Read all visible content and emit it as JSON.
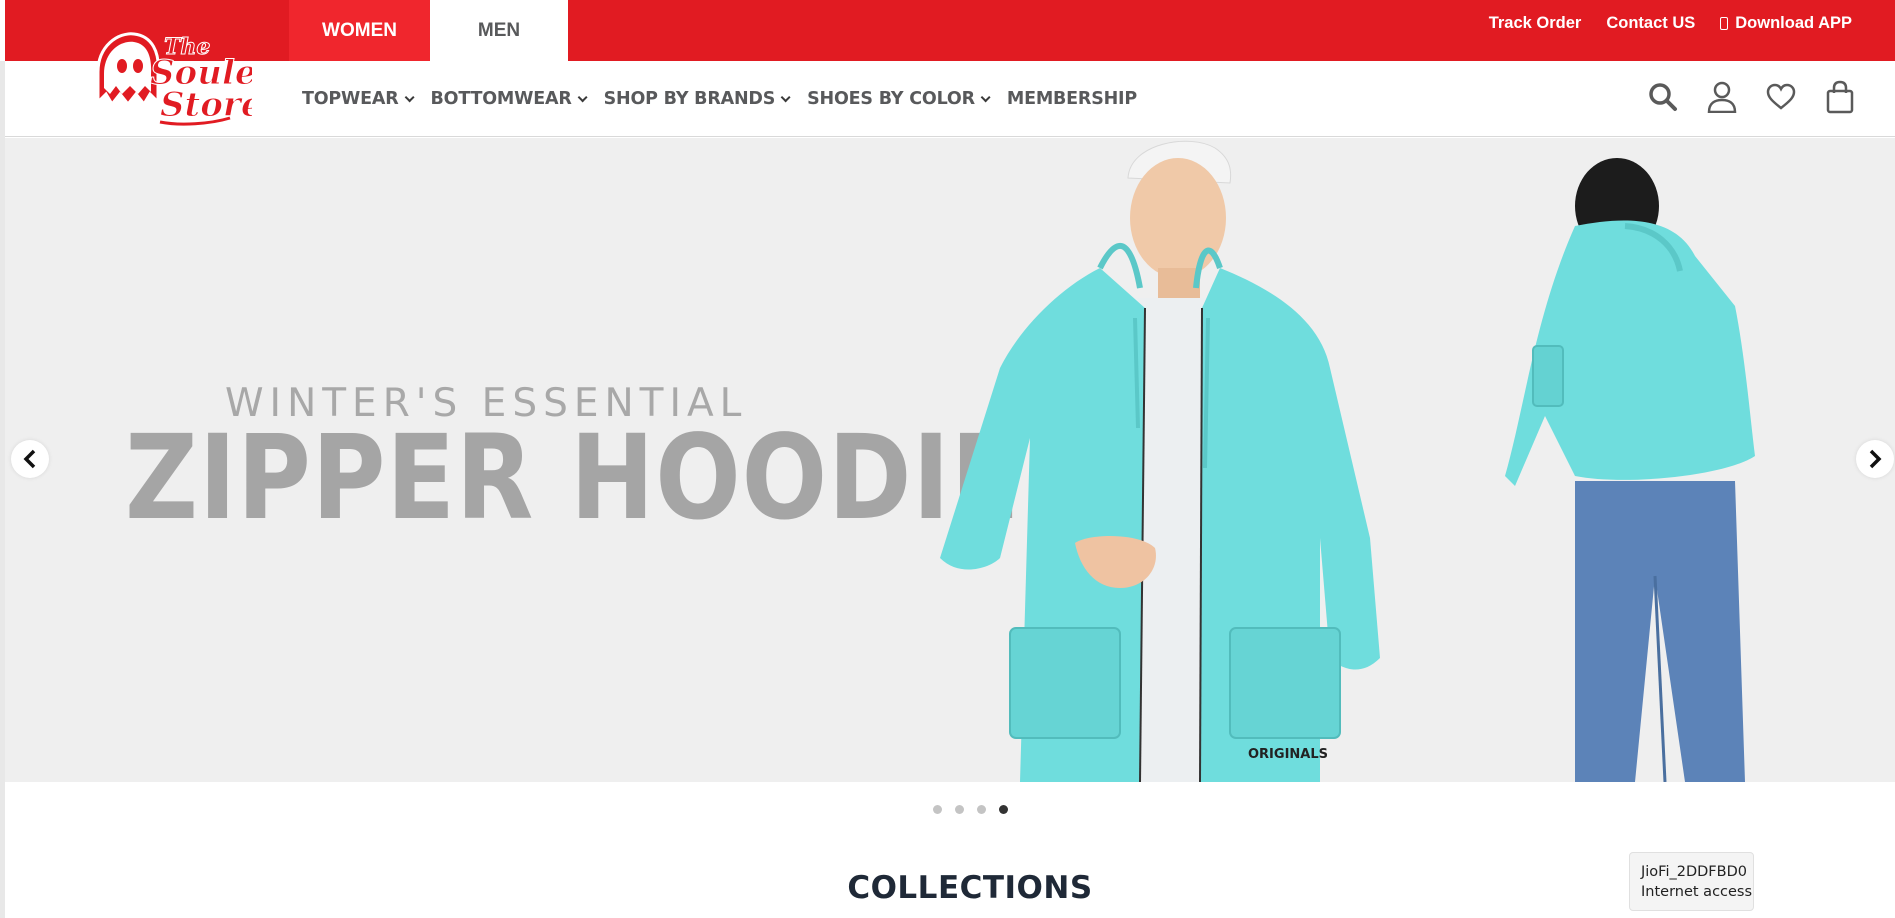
{
  "header": {
    "tabs": [
      {
        "label": "WOMEN",
        "active": false
      },
      {
        "label": "MEN",
        "active": true
      }
    ],
    "links": {
      "track_order": "Track Order",
      "contact_us": "Contact US",
      "download_app": "Download APP"
    },
    "accent_color": "#e11b22"
  },
  "logo": {
    "alt": "The Souled Store"
  },
  "nav": {
    "items": [
      {
        "label": "TOPWEAR",
        "has_dropdown": true
      },
      {
        "label": "BOTTOMWEAR",
        "has_dropdown": true
      },
      {
        "label": "SHOP BY BRANDS",
        "has_dropdown": true
      },
      {
        "label": "SHOES BY COLOR",
        "has_dropdown": true
      },
      {
        "label": "MEMBERSHIP",
        "has_dropdown": false
      }
    ],
    "icons": [
      "search-icon",
      "user-icon",
      "heart-icon",
      "bag-icon"
    ]
  },
  "hero": {
    "subtitle": "WINTER'S ESSENTIAL",
    "title": "ZIPPER HOODIE",
    "garment_label": "ORIGINALS",
    "slide_count": 4,
    "active_slide": 4,
    "hoodie_color": "#6fdddd"
  },
  "section": {
    "title": "COLLECTIONS"
  },
  "network_tooltip": {
    "ssid": "JioFi_2DDFBD0",
    "status": "Internet access"
  }
}
